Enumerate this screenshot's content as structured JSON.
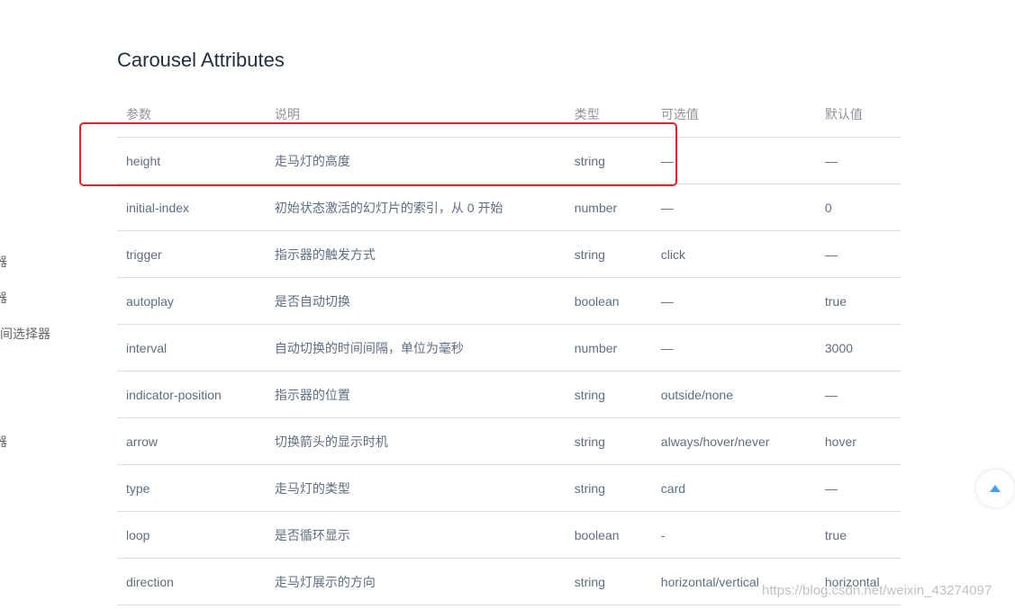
{
  "sidebar_fragments": [
    "器",
    "器",
    "时间选择器",
    "器"
  ],
  "section": {
    "title": "Carousel Attributes"
  },
  "table": {
    "headers": [
      "参数",
      "说明",
      "类型",
      "可选值",
      "默认值"
    ],
    "rows": [
      [
        "height",
        "走马灯的高度",
        "string",
        "—",
        "—"
      ],
      [
        "initial-index",
        "初始状态激活的幻灯片的索引，从 0 开始",
        "number",
        "—",
        "0"
      ],
      [
        "trigger",
        "指示器的触发方式",
        "string",
        "click",
        "—"
      ],
      [
        "autoplay",
        "是否自动切换",
        "boolean",
        "—",
        "true"
      ],
      [
        "interval",
        "自动切换的时间间隔，单位为毫秒",
        "number",
        "—",
        "3000"
      ],
      [
        "indicator-position",
        "指示器的位置",
        "string",
        "outside/none",
        "—"
      ],
      [
        "arrow",
        "切换箭头的显示时机",
        "string",
        "always/hover/never",
        "hover"
      ],
      [
        "type",
        "走马灯的类型",
        "string",
        "card",
        "—"
      ],
      [
        "loop",
        "是否循环显示",
        "boolean",
        "-",
        "true"
      ],
      [
        "direction",
        "走马灯展示的方向",
        "string",
        "horizontal/vertical",
        "horizontal"
      ]
    ]
  },
  "highlight": {
    "color": "#e8222a"
  },
  "back_to_top": {
    "icon": "caret-up-icon",
    "color": "#409eff"
  },
  "watermark": "https://blog.csdn.net/weixin_43274097"
}
